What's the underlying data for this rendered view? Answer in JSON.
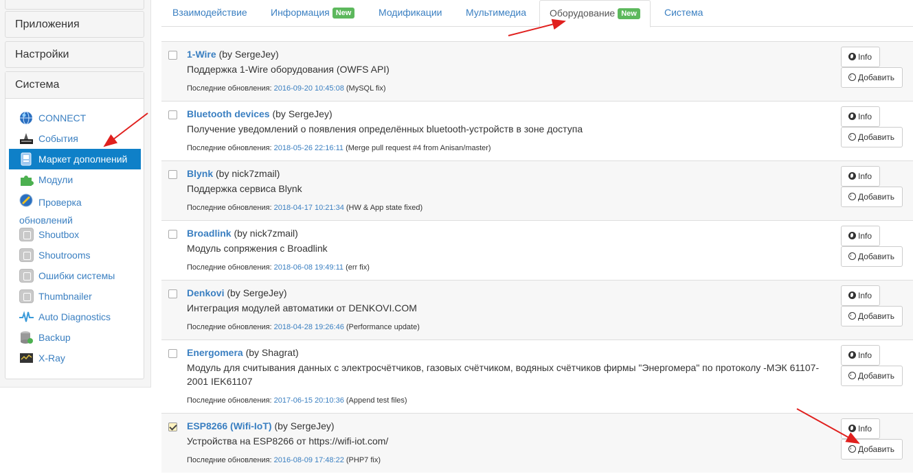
{
  "sidebar": {
    "apps_label": "Приложения",
    "settings_label": "Настройки",
    "system_label": "Система",
    "items": [
      {
        "label": "CONNECT",
        "icon": "connect-globe-icon"
      },
      {
        "label": "События",
        "icon": "events-icon"
      },
      {
        "label": "Маркет дополнений",
        "icon": "market-icon"
      },
      {
        "label": "Модули",
        "icon": "puzzle-icon"
      },
      {
        "label": "Проверка",
        "label2": "обновлений",
        "icon": "update-check-icon"
      },
      {
        "label": "Shoutbox",
        "icon": "m-box-icon"
      },
      {
        "label": "Shoutrooms",
        "icon": "m-box-icon"
      },
      {
        "label": "Ошибки системы",
        "icon": "m-box-icon"
      },
      {
        "label": "Thumbnailer",
        "icon": "m-box-icon"
      },
      {
        "label": "Auto Diagnostics",
        "icon": "diagnostics-wave-icon"
      },
      {
        "label": "Backup",
        "icon": "backup-db-icon"
      },
      {
        "label": "X-Ray",
        "icon": "xray-monitor-icon"
      }
    ],
    "active_item": "Маркет дополнений",
    "active_color": "#0f80c8"
  },
  "tabs": [
    {
      "label": "Взаимодействие"
    },
    {
      "label": "Информация",
      "badge": "New"
    },
    {
      "label": "Модификации"
    },
    {
      "label": "Мультимедиа"
    },
    {
      "label": "Оборудование",
      "badge": "New",
      "active": true
    },
    {
      "label": "Система"
    }
  ],
  "list": {
    "updated_prefix": "Последние обновления:",
    "info_label": "Info",
    "add_label": "Добавить",
    "items": [
      {
        "name": "1-Wire",
        "author": "(by SergeJey)",
        "desc": "Поддержка 1-Wire оборудования (OWFS API)",
        "date": "2016-09-20 10:45:08",
        "note": "(MySQL fix)",
        "checked": false
      },
      {
        "name": "Bluetooth devices",
        "author": "(by SergeJey)",
        "desc": "Получение уведомлений о появления определённых bluetooth-устройств в зоне доступа",
        "date": "2018-05-26 22:16:11",
        "note": "(Merge pull request #4 from Anisan/master)",
        "checked": false
      },
      {
        "name": "Blynk",
        "author": "(by nick7zmail)",
        "desc": "Поддержка сервиса Blynk",
        "date": "2018-04-17 10:21:34",
        "note": "(HW & App state fixed)",
        "checked": false
      },
      {
        "name": "Broadlink",
        "author": "(by nick7zmail)",
        "desc": "Модуль сопряжения с Broadlink",
        "date": "2018-06-08 19:49:11",
        "note": "(err fix)",
        "checked": false
      },
      {
        "name": "Denkovi",
        "author": "(by SergeJey)",
        "desc": "Интеграция модулей автоматики от DENKOVI.COM",
        "date": "2018-04-28 19:26:46",
        "note": "(Performance update)",
        "checked": false
      },
      {
        "name": "Energomera",
        "author": "(by Shagrat)",
        "desc": "Модуль для считывания данных с электросчётчиков, газовых счётчиком, водяных счётчиков фирмы \"Энергомера\" по протоколу -МЭК 61107-2001 IEK61107",
        "date": "2017-06-15 20:10:36",
        "note": "(Append test files)",
        "checked": false
      },
      {
        "name": "ESP8266 (Wifi-IoT)",
        "author": "(by SergeJey)",
        "desc": "Устройства на ESP8266 от https://wifi-iot.com/",
        "date": "2016-08-09 17:48:22",
        "note": "(PHP7 fix)",
        "checked": true
      }
    ]
  },
  "colors": {
    "link": "#3a7fc1",
    "badge": "#5cb85c",
    "arrow": "#e0201e"
  }
}
